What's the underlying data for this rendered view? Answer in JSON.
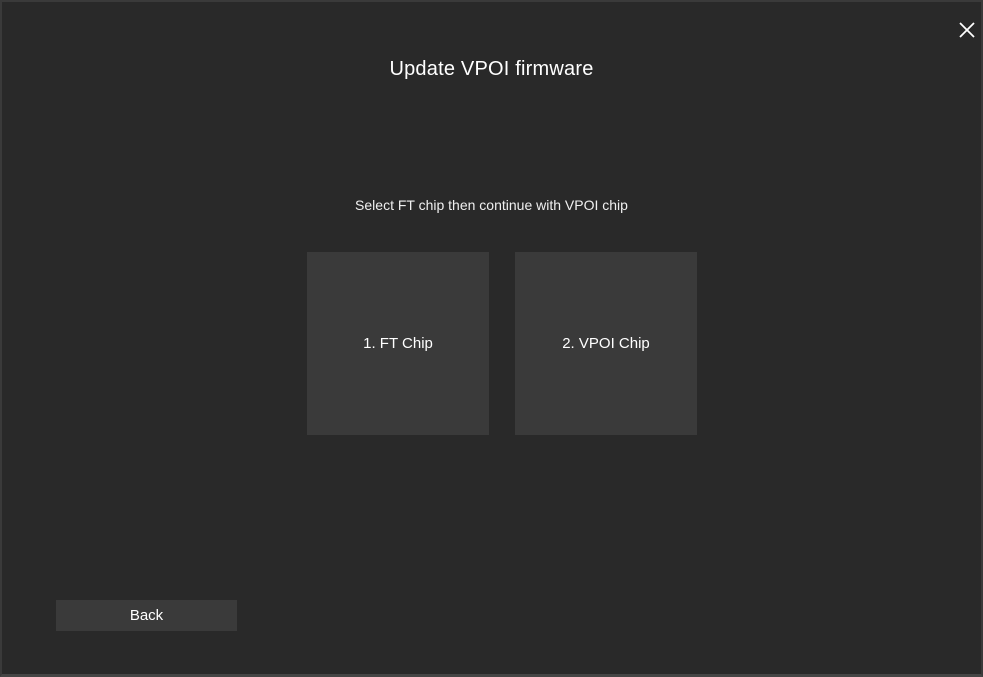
{
  "dialog": {
    "title": "Update VPOI firmware",
    "instruction": "Select FT chip then continue with VPOI chip",
    "close_icon": "close-icon"
  },
  "chips": [
    {
      "label": "1. FT Chip"
    },
    {
      "label": "2. VPOI Chip"
    }
  ],
  "footer": {
    "back_label": "Back"
  },
  "colors": {
    "background": "#292929",
    "tile": "#3a3a3a",
    "text": "#ffffff"
  }
}
